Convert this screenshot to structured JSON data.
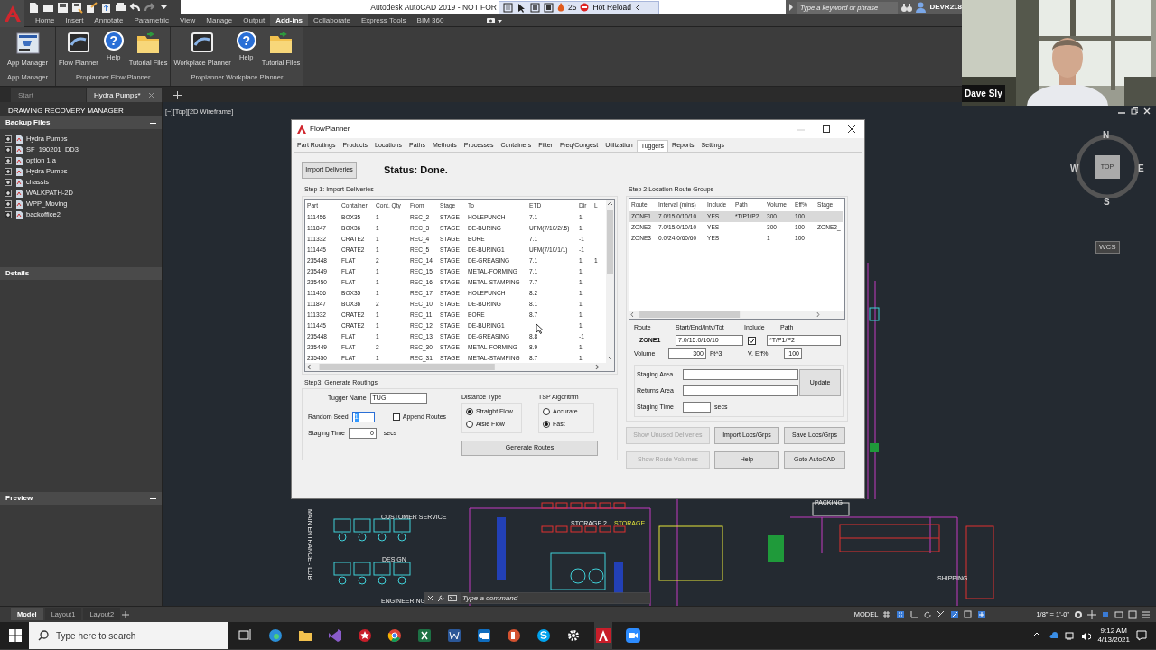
{
  "titlebar": {
    "title": "Autodesk AutoCAD 2019 - NOT FOR",
    "counter": "25",
    "hot_reload": "Hot Reload",
    "search": {
      "placeholder": "Type a keyword or phrase"
    },
    "user": "DEVR218"
  },
  "ribbon": {
    "tabs": [
      {
        "label": "Home",
        "selected": false
      },
      {
        "label": "Insert",
        "selected": false
      },
      {
        "label": "Annotate",
        "selected": false
      },
      {
        "label": "Parametric",
        "selected": false
      },
      {
        "label": "View",
        "selected": false
      },
      {
        "label": "Manage",
        "selected": false
      },
      {
        "label": "Output",
        "selected": false
      },
      {
        "label": "Add-ins",
        "selected": true
      },
      {
        "label": "Collaborate",
        "selected": false
      },
      {
        "label": "Express Tools",
        "selected": false
      },
      {
        "label": "BIM 360",
        "selected": false
      }
    ],
    "panels": [
      {
        "title": "App Manager",
        "tools": [
          {
            "label": "App Manager",
            "kind": "app"
          }
        ]
      },
      {
        "title": "Proplanner Flow Planner",
        "tools": [
          {
            "label": "Flow Planner",
            "kind": "planner"
          },
          {
            "label": "Help",
            "kind": "help",
            "icon_text": "?"
          },
          {
            "label": "Tutorial Files",
            "kind": "folder"
          }
        ]
      },
      {
        "title": "Proplanner Workplace Planner",
        "tools": [
          {
            "label": "Workplace Planner",
            "kind": "planner"
          },
          {
            "label": "Help",
            "kind": "help",
            "icon_text": "?"
          },
          {
            "label": "Tutorial Files",
            "kind": "folder"
          }
        ]
      }
    ]
  },
  "file_tabs": [
    {
      "label": "Start",
      "selected": false
    },
    {
      "label": "Hydra Pumps*",
      "selected": true
    }
  ],
  "video": {
    "kind": "picture",
    "name": "Dave Sly"
  },
  "palette": {
    "title": "DRAWING RECOVERY MANAGER",
    "sections": [
      {
        "title": "Backup Files",
        "expanded": true,
        "items": [
          {
            "label": "Hydra Pumps",
            "expanded": false
          },
          {
            "label": "SF_190201_DD3",
            "expanded": false
          },
          {
            "label": "option 1 a",
            "expanded": false
          },
          {
            "label": "Hydra Pumps",
            "expanded": false
          },
          {
            "label": "chassis",
            "expanded": false
          },
          {
            "label": "WALKPATH-2D",
            "expanded": false
          },
          {
            "label": "WPP_Moving",
            "expanded": false
          },
          {
            "label": "backoffice2",
            "expanded": false
          }
        ]
      },
      {
        "title": "Details",
        "expanded": true
      },
      {
        "title": "Preview",
        "expanded": true
      }
    ]
  },
  "viewport": {
    "label": "[−][Top][2D Wireframe]",
    "compass": {
      "n": "N",
      "s": "S",
      "e": "E",
      "w": "W",
      "face": "TOP",
      "ucs": "WCS"
    },
    "plan_labels": [
      "CUSTOMER SERVICE",
      "STORAGE 2",
      "STORAGE",
      "DESIGN",
      "ENGINEERING",
      "PACKING",
      "SHIPPING",
      "MAIN ENTRANCE - LOB"
    ]
  },
  "dialog": {
    "title": "FlowPlanner",
    "tabs": [
      {
        "label": "Part Routings",
        "selected": false
      },
      {
        "label": "Products",
        "selected": false
      },
      {
        "label": "Locations",
        "selected": false
      },
      {
        "label": "Paths",
        "selected": false
      },
      {
        "label": "Methods",
        "selected": false
      },
      {
        "label": "Processes",
        "selected": false
      },
      {
        "label": "Containers",
        "selected": false
      },
      {
        "label": "Filter",
        "selected": false
      },
      {
        "label": "Freq/Congest",
        "selected": false
      },
      {
        "label": "Utilization",
        "selected": false
      },
      {
        "label": "Tuggers",
        "selected": true
      },
      {
        "label": "Reports",
        "selected": false
      },
      {
        "label": "Settings",
        "selected": false
      }
    ],
    "import_button": "Import Deliveries",
    "status": "Status:  Done.",
    "step1": {
      "title": "Step 1: Import Deliveries",
      "columns": [
        "Part",
        "Container",
        "Cont. Qty",
        "From",
        "Stage",
        "To",
        "ETD",
        "Dir",
        "L"
      ],
      "rows": [
        [
          "111456",
          "BOX35",
          "1",
          "REC_2",
          "STAGE",
          "HOLEPUNCH",
          "7.1",
          "1",
          null
        ],
        [
          "111847",
          "BOX36",
          "1",
          "REC_3",
          "STAGE",
          "DE-BURING",
          "UFM(7/10/2/.5)",
          "1",
          null
        ],
        [
          "111332",
          "CRATE2",
          "1",
          "REC_4",
          "STAGE",
          "BORE",
          "7.1",
          "-1",
          null
        ],
        [
          "111445",
          "CRATE2",
          "1",
          "REC_5",
          "STAGE",
          "DE-BURING1",
          "UFM(7/10/1/1)",
          "-1",
          null
        ],
        [
          "235448",
          "FLAT",
          "2",
          "REC_14",
          "STAGE",
          "DE-GREASING",
          "7.1",
          "1",
          "1"
        ],
        [
          "235449",
          "FLAT",
          "1",
          "REC_15",
          "STAGE",
          "METAL-FORMING",
          "7.1",
          "1",
          null
        ],
        [
          "235450",
          "FLAT",
          "1",
          "REC_16",
          "STAGE",
          "METAL-STAMPING",
          "7.7",
          "1",
          null
        ],
        [
          "111456",
          "BOX35",
          "1",
          "REC_17",
          "STAGE",
          "HOLEPUNCH",
          "8.2",
          "1",
          null
        ],
        [
          "111847",
          "BOX36",
          "2",
          "REC_10",
          "STAGE",
          "DE-BURING",
          "8.1",
          "1",
          null
        ],
        [
          "111332",
          "CRATE2",
          "1",
          "REC_11",
          "STAGE",
          "BORE",
          "8.7",
          "1",
          null
        ],
        [
          "111445",
          "CRATE2",
          "1",
          "REC_12",
          "STAGE",
          "DE-BURING1",
          null,
          "1",
          null
        ],
        [
          "235448",
          "FLAT",
          "1",
          "REC_13",
          "STAGE",
          "DE-GREASING",
          "8.8",
          "-1",
          null
        ],
        [
          "235449",
          "FLAT",
          "2",
          "REC_30",
          "STAGE",
          "METAL-FORMING",
          "8.9",
          "1",
          null
        ],
        [
          "235450",
          "FLAT",
          "1",
          "REC_31",
          "STAGE",
          "METAL-STAMPING",
          "8.7",
          "1",
          null
        ]
      ]
    },
    "step2": {
      "title": "Step 2:Location Route Groups",
      "columns": [
        "Route",
        "Interval (mins)",
        "Include",
        "Path",
        "Volume",
        "Eff%",
        "Stage"
      ],
      "rows": [
        {
          "cells": [
            "ZONE1",
            "7.0/15.0/10/10",
            "YES",
            "*T/P1/P2",
            "300",
            "100",
            null
          ],
          "selected": true
        },
        {
          "cells": [
            "ZONE2",
            "7.0/15.0/10/10",
            "YES",
            null,
            "300",
            "100",
            "ZONE2_"
          ],
          "selected": false
        },
        {
          "cells": [
            "ZONE3",
            "0.0/24.0/60/60",
            "YES",
            null,
            "1",
            "100",
            null
          ],
          "selected": false
        }
      ],
      "form": {
        "route_label": "Route",
        "range_label": "Start/End/Intv/Tot",
        "include_label": "Include",
        "path_label": "Path",
        "route": "ZONE1",
        "range": "7.0/15.0/10/10",
        "include": true,
        "path": "*T/P1/P2",
        "volume_label": "Volume",
        "volume": "300",
        "volume_unit": "Ft^3",
        "eff_label": "V. Eff%",
        "eff": "100",
        "staging_area_label": "Staging Area",
        "returns_area_label": "Returns Area",
        "staging_time_label": "Staging Time",
        "staging_time_unit": "secs",
        "update": "Update"
      },
      "buttons": [
        {
          "label": "Show Unused Deliveries",
          "disabled": true
        },
        {
          "label": "Import Locs/Grps",
          "disabled": false
        },
        {
          "label": "Save Locs/Grps",
          "disabled": false
        },
        {
          "label": "Show Route Volumes",
          "disabled": true
        },
        {
          "label": "Help",
          "disabled": false
        },
        {
          "label": "Goto AutoCAD",
          "disabled": false
        }
      ]
    },
    "step3": {
      "title": "Step3: Generate Routings",
      "tugger_label": "Tugger Name",
      "tugger": "TUG",
      "seed_label": "Random Seed",
      "seed": "1",
      "append": {
        "label": "Append Routes",
        "checked": false
      },
      "staging_label": "Staging Time",
      "staging": "0",
      "staging_unit": "secs",
      "groups": [
        {
          "title": "Distance Type",
          "options": [
            {
              "label": "Straight Flow",
              "selected": true
            },
            {
              "label": "Aisle Flow",
              "selected": false
            }
          ]
        },
        {
          "title": "TSP Algorithm",
          "options": [
            {
              "label": "Accurate",
              "selected": false
            },
            {
              "label": "Fast",
              "selected": true
            }
          ]
        }
      ],
      "generate": "Generate Routes"
    }
  },
  "command_line": {
    "placeholder": "Type a command"
  },
  "layout_tabs": [
    {
      "label": "Model",
      "selected": true
    },
    {
      "label": "Layout1",
      "selected": false
    },
    {
      "label": "Layout2",
      "selected": false
    }
  ],
  "status_bar": {
    "model": "MODEL",
    "scale": "1/8\" = 1'-0\""
  },
  "taskbar": {
    "search_placeholder": "Type here to search",
    "time": "9:12 AM",
    "date": "4/13/2021"
  }
}
